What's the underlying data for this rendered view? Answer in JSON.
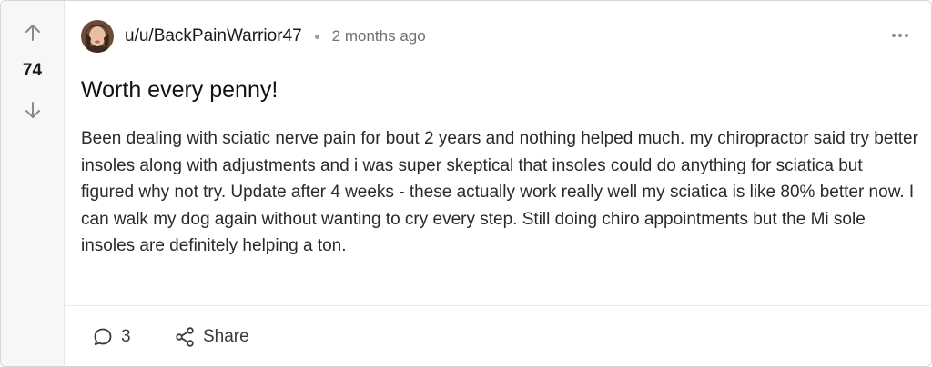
{
  "post": {
    "votes": "74",
    "username": "u/u/BackPainWarrior47",
    "time": "2 months ago",
    "title": "Worth every penny!",
    "body": "Been dealing with sciatic nerve pain for bout 2 years and nothing helped much. my chiropractor said try better insoles along with adjustments and i was super skeptical that insoles could do anything for sciatica but figured why not try. Update after 4 weeks - these actually work really well my sciatica is like 80% better now. I can walk my dog again without wanting to cry every step. Still doing chiro appointments but the Mi sole insoles are definitely helping a ton.",
    "comments_count": "3",
    "share_label": "Share"
  },
  "icons": {
    "upvote": "arrow-up-icon",
    "downvote": "arrow-down-icon",
    "more": "more-horizontal-icon",
    "comment": "comment-icon",
    "share": "share-icon"
  },
  "colors": {
    "vote_column_bg": "#f7f7f8",
    "text_primary": "#1a1a1b",
    "text_muted": "#6f6f6f",
    "icon_gray": "#8a8a8a"
  }
}
